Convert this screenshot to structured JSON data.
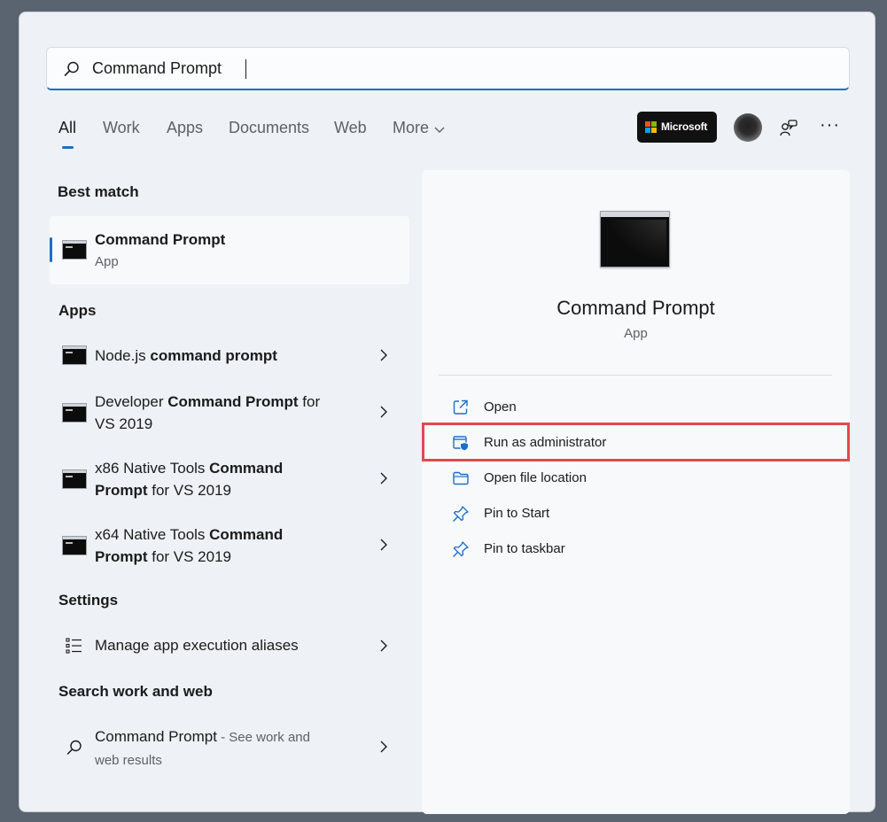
{
  "search": {
    "value": "Command Prompt",
    "placeholder": ""
  },
  "tabs": [
    {
      "label": "All",
      "active": true
    },
    {
      "label": "Work"
    },
    {
      "label": "Apps"
    },
    {
      "label": "Documents"
    },
    {
      "label": "Web"
    },
    {
      "label": "More"
    }
  ],
  "header_buttons": {
    "microsoft_label": "Microsoft",
    "more_label": "···"
  },
  "sections": {
    "best_match": "Best match",
    "apps": "Apps",
    "settings": "Settings",
    "search_web": "Search work and web"
  },
  "best_match": {
    "title": "Command Prompt",
    "subtitle": "App"
  },
  "apps": [
    {
      "plain_pre": "Node.js ",
      "bold": "command prompt",
      "plain_post": "",
      "line2_bold": "",
      "line2_plain": ""
    },
    {
      "plain_pre": "Developer ",
      "bold": "Command Prompt",
      "plain_post": " for",
      "line2_bold": "",
      "line2_plain": "VS 2019"
    },
    {
      "plain_pre": "x86 Native Tools ",
      "bold": "Command",
      "plain_post": "",
      "line2_bold": "Prompt",
      "line2_plain": " for VS 2019"
    },
    {
      "plain_pre": "x64 Native Tools ",
      "bold": "Command",
      "plain_post": "",
      "line2_bold": "Prompt",
      "line2_plain": " for VS 2019"
    }
  ],
  "settings": [
    {
      "label": "Manage app execution aliases"
    }
  ],
  "web_search": {
    "query": "Command Prompt",
    "hint": " - See work and",
    "hint2": "web results"
  },
  "preview": {
    "title": "Command Prompt",
    "subtitle": "App",
    "actions": [
      {
        "label": "Open",
        "icon": "open-external-icon"
      },
      {
        "label": "Run as administrator",
        "icon": "shield-window-icon",
        "highlighted": true
      },
      {
        "label": "Open file location",
        "icon": "folder-icon"
      },
      {
        "label": "Pin to Start",
        "icon": "pin-icon"
      },
      {
        "label": "Pin to taskbar",
        "icon": "pin-icon"
      }
    ]
  },
  "colors": {
    "accent": "#1c6ec8",
    "highlight_border": "#e5484d",
    "panel_bg": "#eef1f5",
    "backdrop": "#5a6370"
  }
}
